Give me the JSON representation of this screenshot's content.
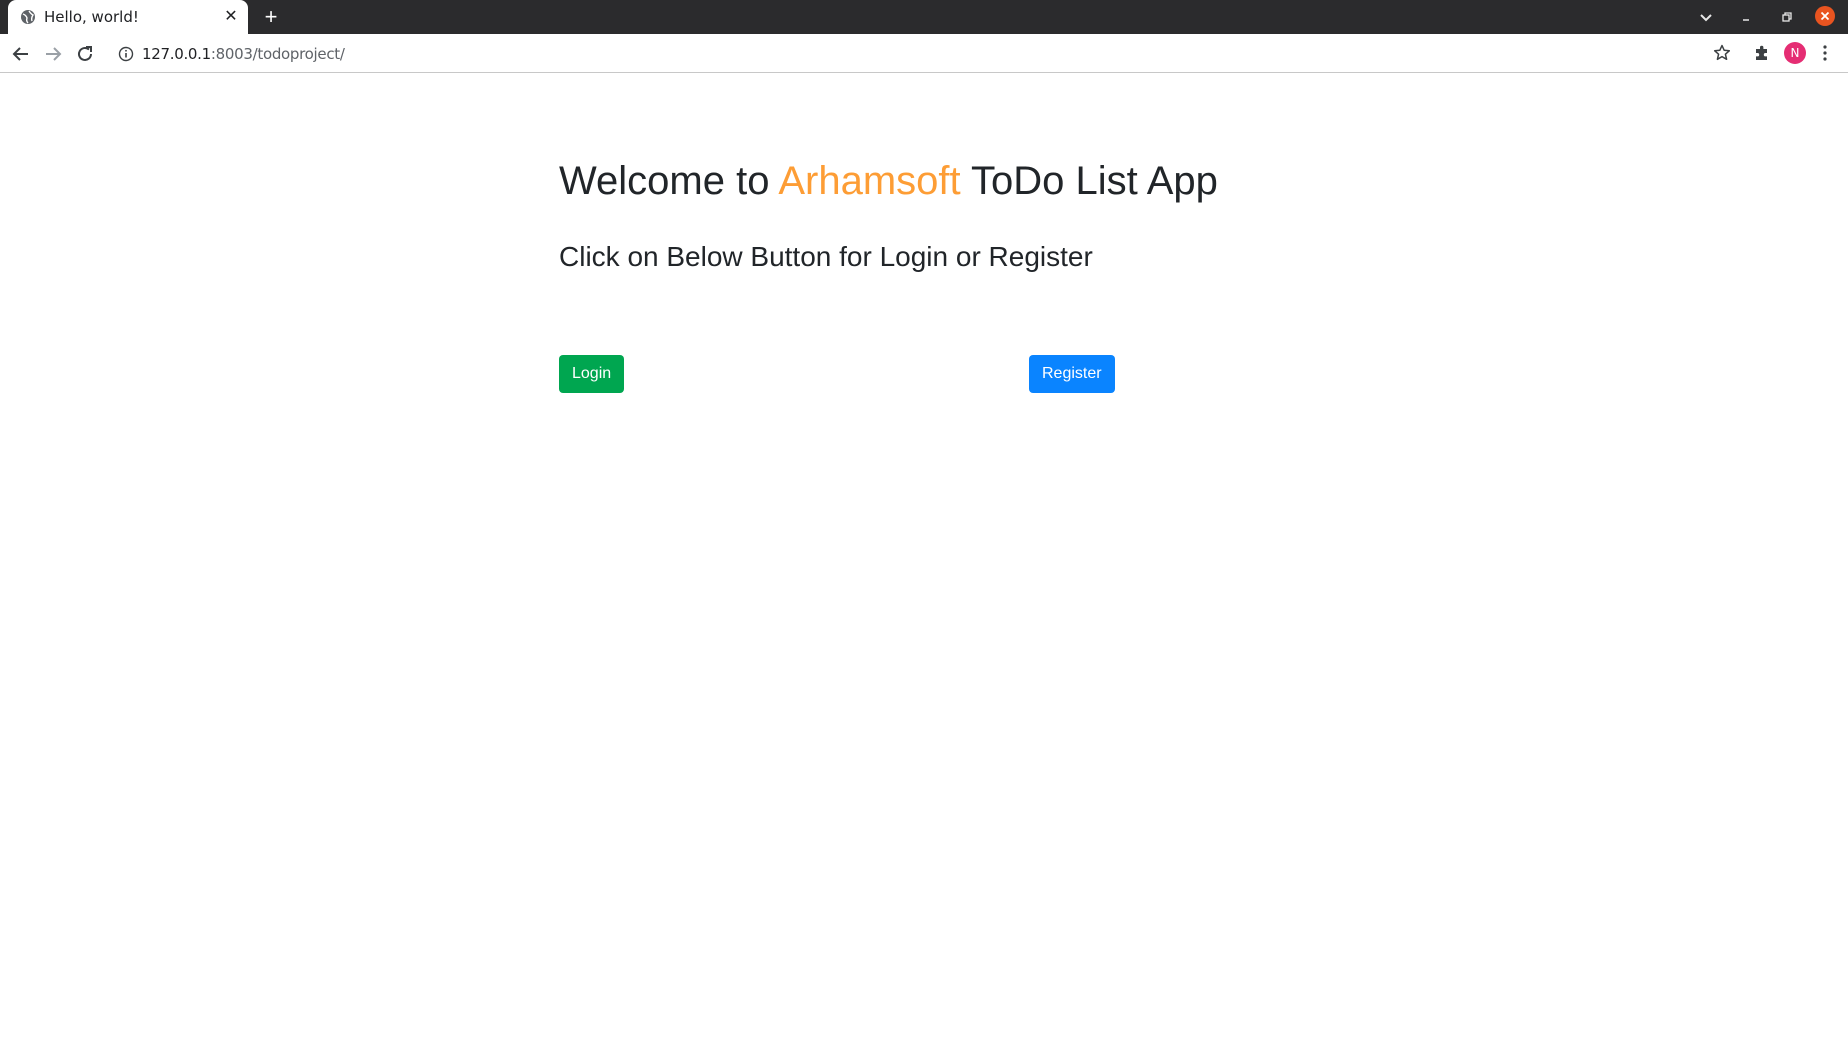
{
  "browser": {
    "tab_title": "Hello, world!",
    "tab_close_glyph": "✕",
    "new_tab_glyph": "+",
    "url_host": "127.0.0.1",
    "url_rest": ":8003/todoproject/",
    "profile_initial": "N",
    "icons": [
      "globe-icon",
      "close-icon",
      "plus-icon",
      "chevron-down-icon",
      "minimize-icon",
      "restore-icon",
      "close-icon",
      "back-arrow-icon",
      "forward-arrow-icon",
      "reload-icon",
      "info-icon",
      "star-icon",
      "puzzle-icon",
      "kebab-menu-icon"
    ]
  },
  "page": {
    "heading_prefix": "Welcome to ",
    "heading_brand": "Arhamsoft",
    "heading_suffix": " ToDo List App",
    "subheading": "Click on Below Button for Login or Register",
    "login_label": "Login",
    "register_label": "Register"
  },
  "colors": {
    "brand": "#fd9d35",
    "login_button": "#00a650",
    "register_button": "#0a84ff",
    "text": "#212529",
    "tab_strip": "#2b2b2d",
    "avatar": "#e52d73",
    "window_close": "#e95420"
  }
}
